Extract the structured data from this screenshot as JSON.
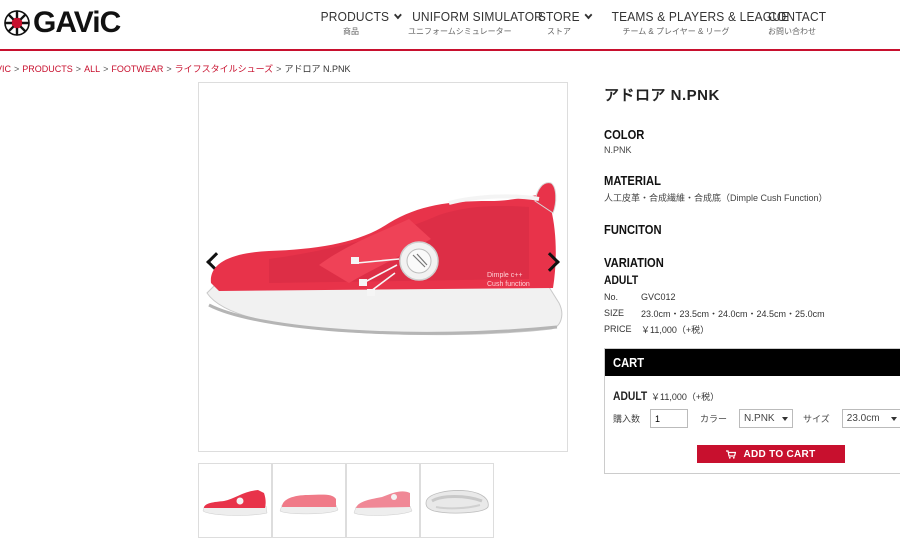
{
  "brand": {
    "logo_text": "GAViC"
  },
  "nav": [
    {
      "label": "PRODUCTS",
      "sub": "商品",
      "dropdown": true
    },
    {
      "label": "UNIFORM SIMULATOR",
      "sub": "ユニフォームシミュレーター",
      "dropdown": false
    },
    {
      "label": "STORE",
      "sub": "ストア",
      "dropdown": true
    },
    {
      "label": "TEAMS & PLAYERS & LEAGUE",
      "sub": "チーム & プレイヤー & リーグ",
      "dropdown": false
    },
    {
      "label": "CONTACT",
      "sub": "お問い合わせ",
      "dropdown": false
    }
  ],
  "breadcrumb": {
    "links": [
      "VIC",
      "PRODUCTS",
      "ALL",
      "FOOTWEAR",
      "ライフスタイルシューズ"
    ],
    "separator": ">",
    "current": "アドロア N.PNK"
  },
  "product": {
    "title": "アドロア N.PNK",
    "color_head": "COLOR",
    "color_val": "N.PNK",
    "material_head": "MATERIAL",
    "material_val": "人工皮革・合成繊維・合成底（Dimple Cush Function）",
    "function_head": "FUNCITON",
    "variation_head": "VARIATION",
    "adult_head": "ADULT",
    "specs": [
      {
        "k": "No.",
        "v": "GVC012"
      },
      {
        "k": "SIZE",
        "v": "23.0cm・23.5cm・24.0cm・24.5cm・25.0cm"
      },
      {
        "k": "PRICE",
        "v": "￥11,000（+税）"
      }
    ],
    "shoe_print": [
      "Dimple c++",
      "Cush function"
    ],
    "accent": "#e8334a"
  },
  "cart": {
    "head": "CART",
    "adult_label": "ADULT",
    "price": "￥11,000（+税）",
    "qty_label": "購入数",
    "qty_value": "1",
    "color_label": "カラー",
    "color_value": "N.PNK",
    "size_label": "サイズ",
    "size_value": "23.0cm",
    "add_label": "ADD TO CART"
  },
  "colors": {
    "brand_red": "#c8102e",
    "shoe_pink": "#e8334a",
    "black": "#000000"
  }
}
